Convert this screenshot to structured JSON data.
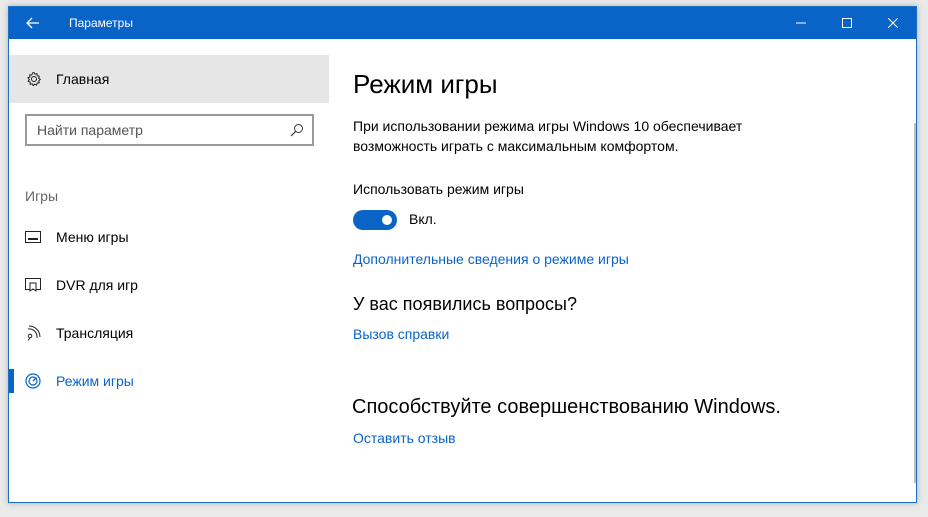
{
  "window": {
    "title": "Параметры",
    "accent": "#0a64c8"
  },
  "titlebar": {
    "back_icon": "arrow-left-icon",
    "controls": [
      "minimize-icon",
      "maximize-icon",
      "close-icon"
    ]
  },
  "sidebar": {
    "home_label": "Главная",
    "home_icon": "gear-icon",
    "search_placeholder": "Найти параметр",
    "search_icon": "search-icon",
    "section_title": "Игры",
    "items": [
      {
        "label": "Меню игры",
        "icon": "game-bar-icon",
        "active": false
      },
      {
        "label": "DVR для игр",
        "icon": "game-dvr-icon",
        "active": false
      },
      {
        "label": "Трансляция",
        "icon": "broadcast-icon",
        "active": false
      },
      {
        "label": "Режим игры",
        "icon": "game-mode-icon",
        "active": true
      }
    ]
  },
  "main": {
    "title": "Режим игры",
    "description": "При использовании режима игры Windows 10 обеспечивает возможность играть с максимальным комфортом.",
    "toggle_label": "Использовать режим игры",
    "toggle_state": "Вкл.",
    "toggle_on": true,
    "more_info_link": "Дополнительные сведения о режиме игры",
    "questions_title": "У вас появились вопросы?",
    "help_link": "Вызов справки",
    "feedback_title": "Способствуйте совершенствованию Windows.",
    "feedback_link": "Оставить отзыв"
  }
}
